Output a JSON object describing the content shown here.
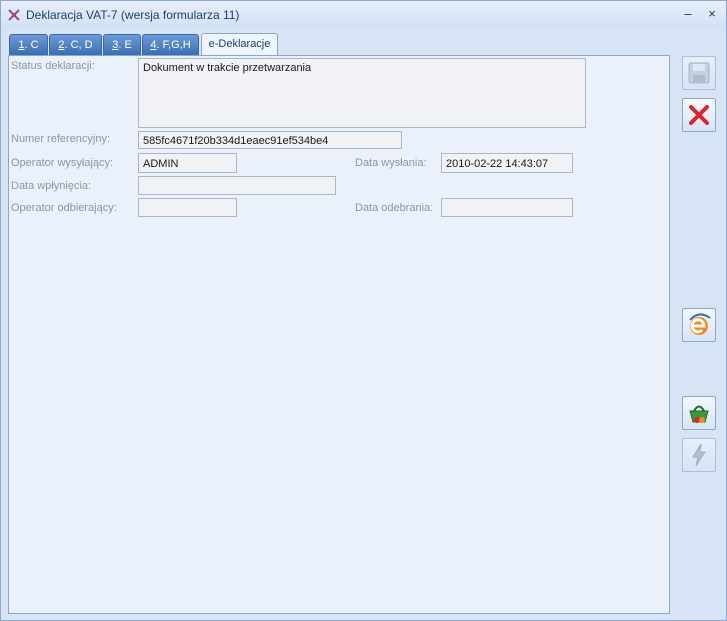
{
  "window": {
    "title": "Deklaracja VAT-7 (wersja formularza 11)",
    "minimize_glyph": "–",
    "close_glyph": "×"
  },
  "tabs": [
    {
      "key": "1",
      "rest": ". C",
      "active": false
    },
    {
      "key": "2",
      "rest": ". C, D",
      "active": false
    },
    {
      "key": "3",
      "rest": ". E",
      "active": false
    },
    {
      "key": "4",
      "rest": ". F,G,H",
      "active": false
    },
    {
      "key": "",
      "rest": "e-Deklaracje",
      "active": true
    }
  ],
  "form": {
    "status_label": "Status deklaracji:",
    "status_value": "Dokument w trakcie przetwarzania",
    "ref_label": "Numer referencyjny:",
    "ref_value": "585fc4671f20b334d1eaec91ef534be4",
    "sender_label": "Operator wysyłający:",
    "sender_value": "ADMIN",
    "sent_date_label": "Data wysłania:",
    "sent_date_value": "2010-02-22 14:43:07",
    "received_label": "Data wpłynięcia:",
    "received_value": "",
    "receiver_label": "Operator odbierający:",
    "receiver_value": "",
    "pickup_date_label": "Data odebrania:",
    "pickup_date_value": ""
  },
  "toolbar": {
    "icons": [
      "save-icon",
      "cancel-icon",
      "e-declaration-icon",
      "basket-icon",
      "lightning-icon"
    ],
    "accent_red": "#d8262a",
    "accent_orange": "#f08a1c",
    "accent_blue": "#3b6db4"
  }
}
